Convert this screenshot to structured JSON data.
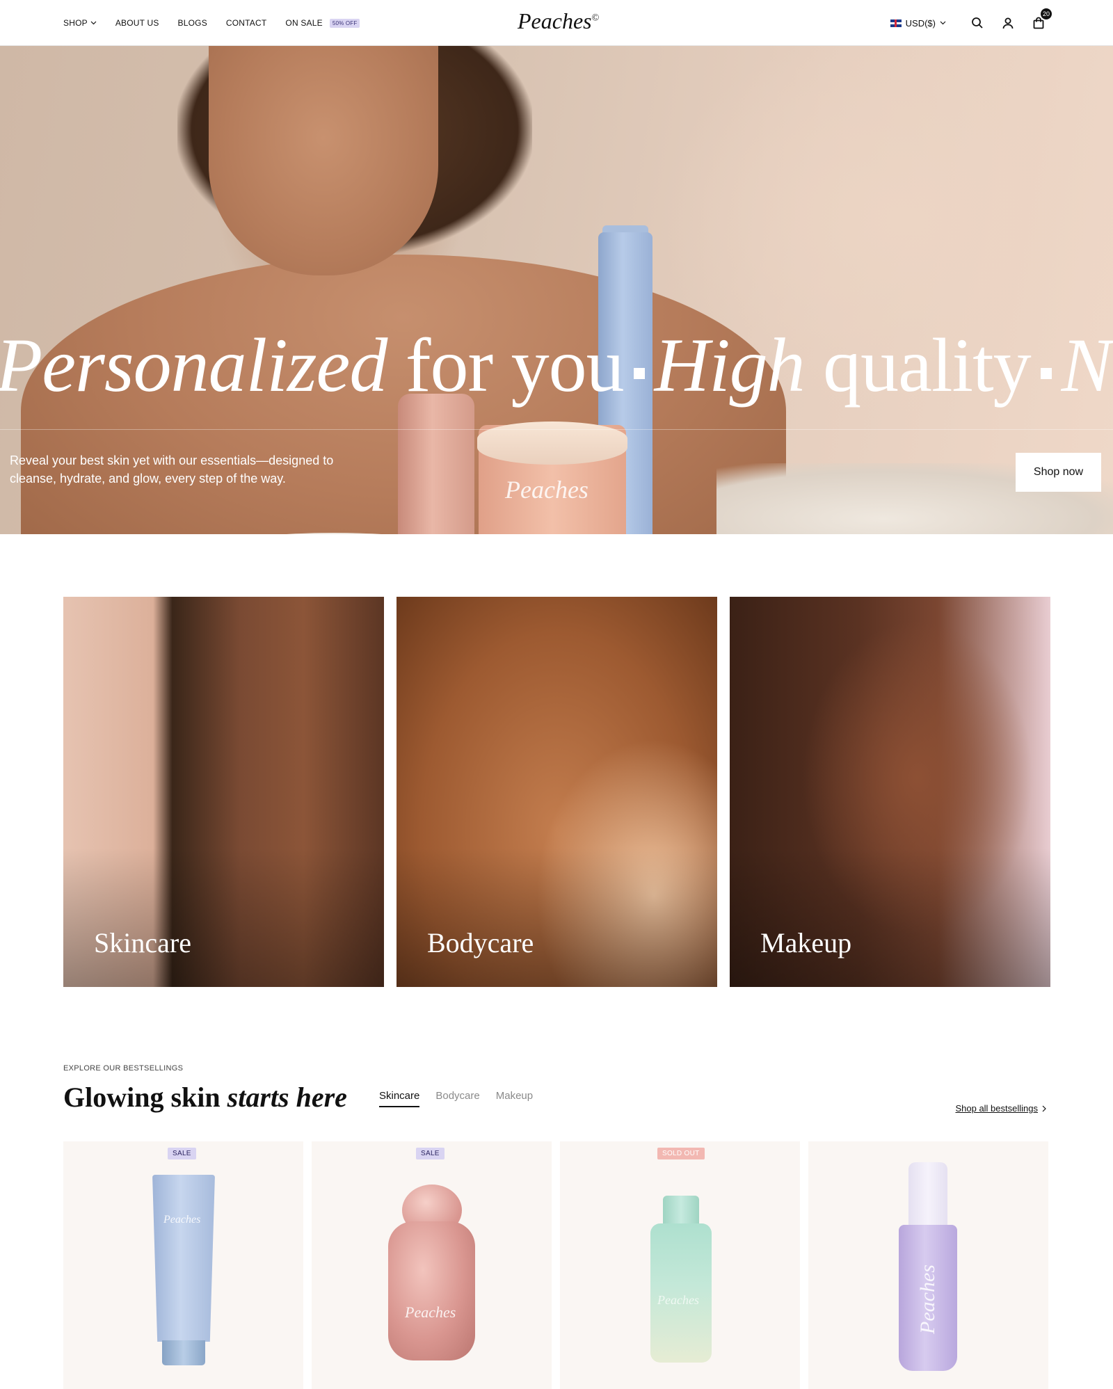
{
  "header": {
    "nav": [
      {
        "label": "SHOP"
      },
      {
        "label": "ABOUT US"
      },
      {
        "label": "BLOGS"
      },
      {
        "label": "CONTACT"
      },
      {
        "label": "ON SALE",
        "badge": "50% OFF"
      }
    ],
    "logo": "Peaches",
    "logo_mark": "©",
    "currency": "USD($)",
    "cart_count": "20"
  },
  "hero": {
    "marquee": [
      "Personalized",
      "for you",
      "High",
      "quality",
      "N"
    ],
    "copy": "Reveal your best skin yet with our essentials—designed to cleanse, hydrate, and glow, every step of the way.",
    "cta": "Shop now",
    "product_brand": "Peaches"
  },
  "categories": [
    {
      "label": "Skincare"
    },
    {
      "label": "Bodycare"
    },
    {
      "label": "Makeup"
    }
  ],
  "bestsellings": {
    "eyebrow": "EXPLORE OUR BESTSELLINGS",
    "heading_plain": "Glowing skin",
    "heading_italic": "starts here",
    "tabs": [
      "Skincare",
      "Bodycare",
      "Makeup"
    ],
    "active_tab": "Skincare",
    "shop_all": "Shop all bestsellings",
    "products": [
      {
        "tag": "SALE",
        "brand": "Peaches"
      },
      {
        "tag": "SALE",
        "brand": "Peaches"
      },
      {
        "tag": "SOLD OUT",
        "brand": "Peaches"
      },
      {
        "tag": "",
        "brand": "Peaches"
      }
    ]
  },
  "colors": {
    "accent_sale": "#d9d4f2",
    "accent_sold": "#f2b8b2",
    "text": "#111111"
  }
}
